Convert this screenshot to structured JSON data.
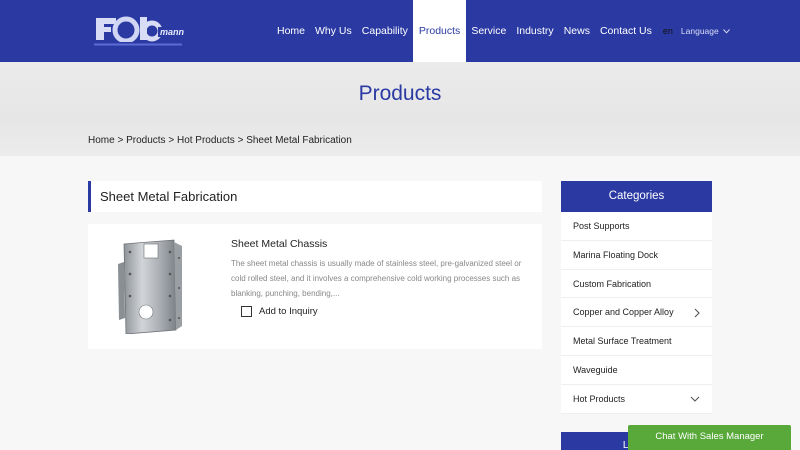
{
  "header": {
    "nav": [
      "Home",
      "Why Us",
      "Capability",
      "Products",
      "Service",
      "Industry",
      "News",
      "Contact Us"
    ],
    "active_nav": "Products",
    "lang_code": "en",
    "language_label": "Language",
    "brand_color": "#2b3aa3"
  },
  "banner": {
    "title": "Products",
    "breadcrumb": [
      "Home",
      "Products",
      "Hot Products",
      "Sheet Metal Fabrication"
    ],
    "separator": ">"
  },
  "main": {
    "section_title": "Sheet Metal Fabrication",
    "products": [
      {
        "name": "Sheet Metal Chassis",
        "description": "The sheet metal chassis is usually made of stainless steel, pre-galvanized steel or cold rolled steel, and it involves a comprehensive cold working processes such as blanking, punching, bending,...",
        "inquiry_label": "Add to Inquiry"
      }
    ]
  },
  "sidebar": {
    "categories_title": "Categories",
    "categories": [
      {
        "label": "Post Supports",
        "icon": ""
      },
      {
        "label": "Marina Floating Dock",
        "icon": ""
      },
      {
        "label": "Custom Fabrication",
        "icon": ""
      },
      {
        "label": "Copper and Copper Alloy",
        "icon": "chevron-right-icon"
      },
      {
        "label": "Metal Surface Treatment",
        "icon": ""
      },
      {
        "label": "Waveguide",
        "icon": ""
      },
      {
        "label": "Hot Products",
        "icon": "chevron-down-icon"
      }
    ],
    "latest_title": "Latest"
  },
  "chat": {
    "label": "Chat With Sales Manager",
    "color": "#58a83a"
  }
}
